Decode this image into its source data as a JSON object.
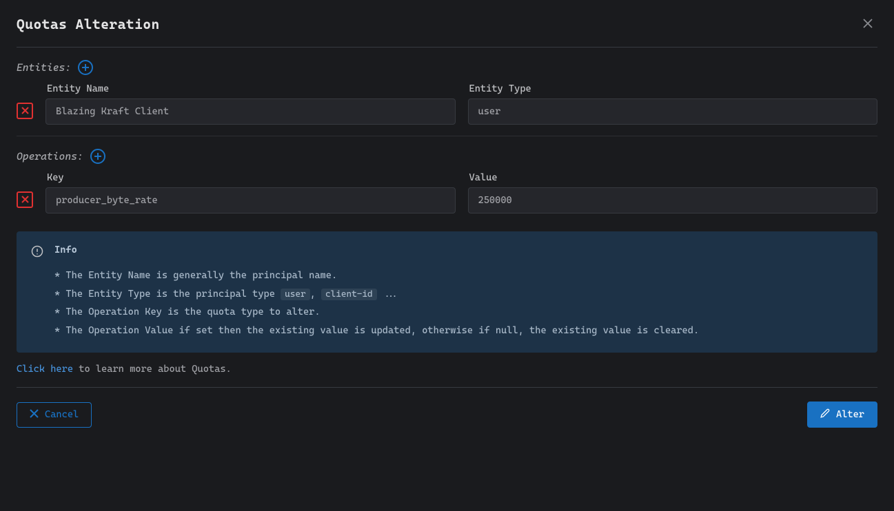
{
  "dialog": {
    "title": "Quotas Alteration"
  },
  "entities": {
    "section_label": "Entities:",
    "name_label": "Entity Name",
    "type_label": "Entity Type",
    "rows": [
      {
        "name": "Blazing Kraft Client",
        "type": "user"
      }
    ]
  },
  "operations": {
    "section_label": "Operations:",
    "key_label": "Key",
    "value_label": "Value",
    "rows": [
      {
        "key": "producer_byte_rate",
        "value": "250000"
      }
    ]
  },
  "info": {
    "title": "Info",
    "line1": "* The Entity Name is generally the principal name.",
    "line2_prefix": "* The Entity Type is the principal type ",
    "line2_chip1": "user",
    "line2_sep": ", ",
    "line2_chip2": "client-id",
    "line2_suffix": " ...",
    "line3": "* The Operation Key is the quota type to alter.",
    "line4": "* The Operation Value if set then the existing value is updated, otherwise if null, the existing value is cleared."
  },
  "learn_more": {
    "link_text": "Click here",
    "rest": " to learn more about Quotas."
  },
  "buttons": {
    "cancel": "Cancel",
    "alter": "Alter"
  }
}
